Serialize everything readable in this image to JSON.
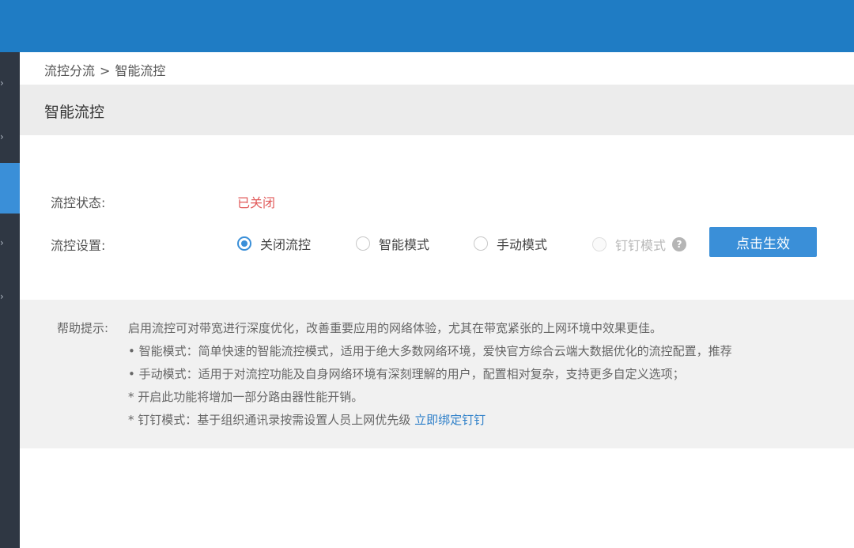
{
  "colors": {
    "topbar": "#1f7cc4",
    "sidebar": "#2f3743",
    "sidebar_active": "#3a8fd8",
    "accent": "#3a8fd8",
    "status_off": "#e15b5b",
    "link": "#2f80c9"
  },
  "sidebar": {
    "items": [
      {
        "icon": "chevron-icon"
      },
      {
        "icon": "chevron-icon"
      },
      {
        "icon": "chevron-icon",
        "active": true
      },
      {
        "icon": "chevron-icon"
      },
      {
        "icon": "chevron-icon"
      }
    ]
  },
  "breadcrumb": {
    "parent": "流控分流",
    "separator": ">",
    "current": "智能流控"
  },
  "section": {
    "title": "智能流控"
  },
  "status": {
    "label": "流控状态:",
    "value": "已关闭"
  },
  "settings": {
    "label": "流控设置:",
    "options": [
      {
        "label": "关闭流控",
        "checked": true,
        "disabled": false
      },
      {
        "label": "智能模式",
        "checked": false,
        "disabled": false
      },
      {
        "label": "手动模式",
        "checked": false,
        "disabled": false
      },
      {
        "label": "钉钉模式",
        "checked": false,
        "disabled": true
      }
    ],
    "help_icon": "question-icon",
    "help_glyph": "?",
    "apply_label": "点击生效"
  },
  "help": {
    "label": "帮助提示:",
    "intro": "启用流控可对带宽进行深度优化，改善重要应用的网络体验，尤其在带宽紧张的上网环境中效果更佳。",
    "smart": "• 智能模式：简单快速的智能流控模式，适用于绝大多数网络环境，爱快官方综合云端大数据优化的流控配置，推荐",
    "manual": "• 手动模式：适用于对流控功能及自身网络环境有深刻理解的用户，配置相对复杂，支持更多自定义选项；",
    "note": "* 开启此功能将增加一部分路由器性能开销。",
    "dingtalk": "* 钉钉模式：基于组织通讯录按需设置人员上网优先级",
    "dingtalk_link": "立即绑定钉钉"
  }
}
